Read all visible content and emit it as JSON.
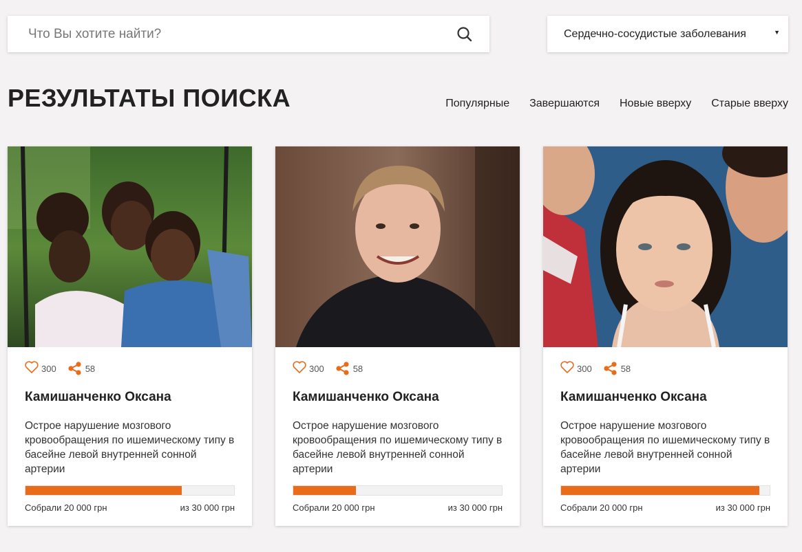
{
  "search": {
    "placeholder": "Что Вы хотите найти?",
    "icon": "search-icon"
  },
  "category_select": {
    "selected": "Сердечно-сосудистые заболевания",
    "icon": "caret-down-icon"
  },
  "page": {
    "title": "РЕЗУЛЬТАТЫ ПОИСКА"
  },
  "sort": {
    "items": [
      {
        "label": "Популярные"
      },
      {
        "label": "Завершаются"
      },
      {
        "label": "Новые вверху"
      },
      {
        "label": "Старые вверху"
      }
    ]
  },
  "colors": {
    "accent": "#e86c1a",
    "background": "#f4f2f3"
  },
  "cards": [
    {
      "likes": "300",
      "shares": "58",
      "name": "Камишанченко Оксана",
      "description": "Острое нарушение мозгового кровообращения по ишемическому типу в басейне левой внутренней сонной артерии",
      "progress": 0.75,
      "collected": "Собрали 20 000 грн",
      "goal": "из 30 000 грн"
    },
    {
      "likes": "300",
      "shares": "58",
      "name": "Камишанченко Оксана",
      "description": "Острое нарушение мозгового кровообращения по ишемическому типу в басейне левой внутренней сонной артерии",
      "progress": 0.3,
      "collected": "Собрали 20 000 грн",
      "goal": "из 30 000 грн"
    },
    {
      "likes": "300",
      "shares": "58",
      "name": "Камишанченко Оксана",
      "description": "Острое нарушение мозгового кровообращения по ишемическому типу в басейне левой внутренней сонной артерии",
      "progress": 0.95,
      "collected": "Собрали 20 000 грн",
      "goal": "из 30 000 грн"
    }
  ]
}
